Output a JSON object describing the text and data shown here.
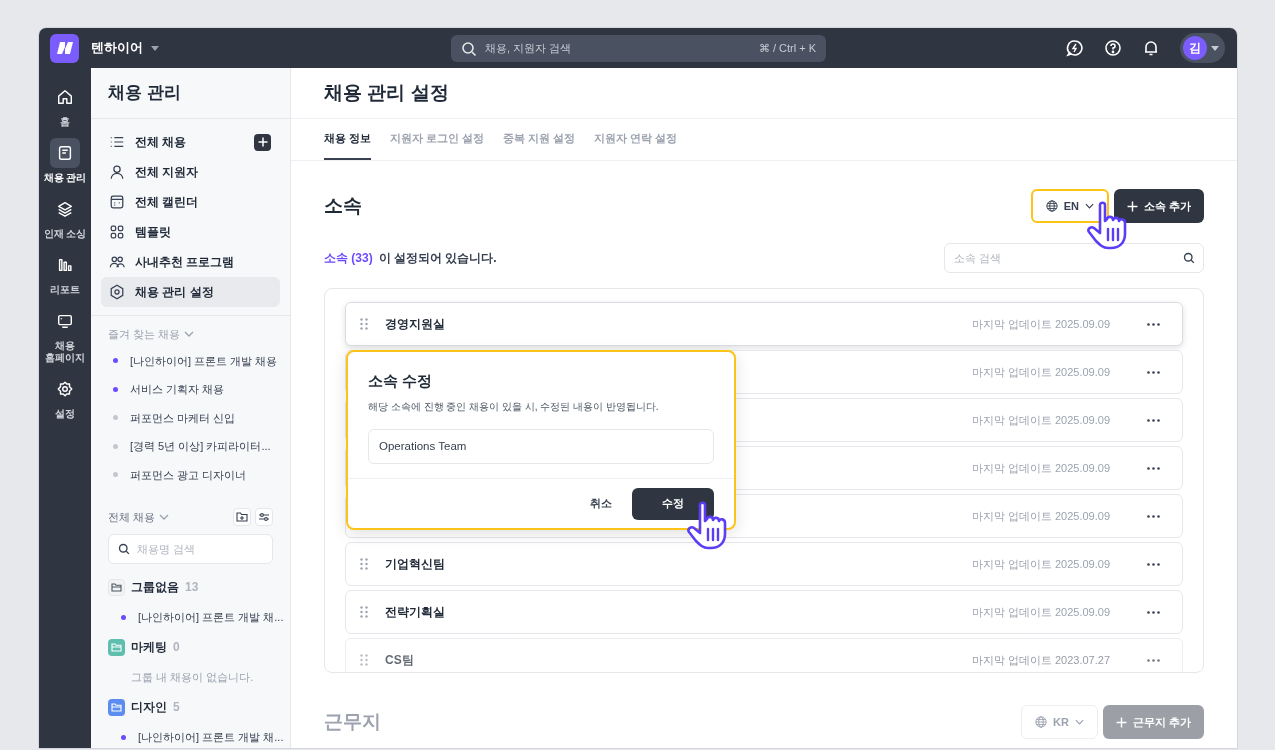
{
  "topbar": {
    "company": "텐하이어",
    "search": {
      "placeholder": "채용, 지원자 검색",
      "shortcut": "⌘ / Ctrl + K"
    },
    "avatar": "김"
  },
  "rail": [
    {
      "label": "홈",
      "selected": false
    },
    {
      "label": "채용 관리",
      "selected": true
    },
    {
      "label": "인재 소싱",
      "selected": false
    },
    {
      "label": "리포트",
      "selected": false
    },
    {
      "label": "채용 홈페이지",
      "selected": false
    },
    {
      "label": "설정",
      "selected": false
    }
  ],
  "sidebar": {
    "title": "채용 관리",
    "nav": [
      {
        "label": "전체 채용",
        "selected": false,
        "has_add": true
      },
      {
        "label": "전체 지원자",
        "selected": false,
        "has_add": false
      },
      {
        "label": "전체 캘린더",
        "selected": false,
        "has_add": false
      },
      {
        "label": "템플릿",
        "selected": false,
        "has_add": false
      },
      {
        "label": "사내추천 프로그램",
        "selected": false,
        "has_add": false
      },
      {
        "label": "채용 관리 설정",
        "selected": true,
        "has_add": false
      }
    ],
    "favorites": {
      "title": "즐겨 찾는 채용",
      "items": [
        {
          "label": "[나인하이어] 프론트 개발 채용",
          "color": "#6d4aff"
        },
        {
          "label": "서비스 기획자 채용",
          "color": "#6d4aff"
        },
        {
          "label": "퍼포먼스 마케터 신입",
          "color": "#c4c7cf"
        },
        {
          "label": "[경력 5년 이상] 카피라이터...",
          "color": "#c4c7cf"
        },
        {
          "label": "퍼포먼스 광고 디자이너",
          "color": "#c4c7cf"
        }
      ]
    },
    "all_jobs": {
      "title": "전체 채용",
      "search_placeholder": "채용명 검색",
      "groups": [
        {
          "name": "그룹없음",
          "count": "13",
          "color": "#f3f4f6",
          "items": [
            {
              "label": "[나인하이어] 프론트 개발 채...",
              "color": "#6d4aff"
            }
          ]
        },
        {
          "name": "마케팅",
          "count": "0",
          "color": "#5fbfae",
          "empty": "그룹 내 채용이 없습니다."
        },
        {
          "name": "디자인",
          "count": "5",
          "color": "#5b8cf0",
          "items": [
            {
              "label": "[나인하이어] 프론트 개발 채...",
              "color": "#6d4aff"
            }
          ]
        }
      ]
    }
  },
  "page": {
    "title": "채용 관리 설정",
    "tabs": [
      {
        "label": "채용 정보",
        "selected": true
      },
      {
        "label": "지원자 로그인 설정",
        "selected": false
      },
      {
        "label": "중복 지원 설정",
        "selected": false
      },
      {
        "label": "지원자 연락 설정",
        "selected": false
      }
    ]
  },
  "sections": [
    {
      "title": "소속",
      "dimmed": false,
      "language": "EN",
      "language_highlighted": true,
      "add_label": "소속 추가",
      "count_link": "소속 (33)",
      "count_text": "이 설정되어 있습니다.",
      "search_placeholder": "소속 검색",
      "rows": [
        {
          "name": "경영지원실",
          "updated": "마지막 업데이트 2025.09.09",
          "raised": true,
          "faded": false
        },
        {
          "updated": "마지막 업데이트 2025.09.09",
          "raised": false,
          "faded": false
        },
        {
          "updated": "마지막 업데이트 2025.09.09",
          "raised": false,
          "faded": false
        },
        {
          "updated": "마지막 업데이트 2025.09.09",
          "raised": false,
          "faded": false
        },
        {
          "updated": "마지막 업데이트 2025.09.09",
          "raised": false,
          "faded": false
        },
        {
          "name": "기업혁신팀",
          "updated": "마지막 업데이트 2025.09.09",
          "raised": false,
          "faded": false
        },
        {
          "name": "전략기획실",
          "updated": "마지막 업데이트 2025.09.09",
          "raised": false,
          "faded": false
        },
        {
          "name": "CS팀",
          "updated": "마지막 업데이트 2023.07.27",
          "raised": false,
          "faded": true
        }
      ]
    },
    {
      "title": "근무지",
      "dimmed": true,
      "language": "KR",
      "language_highlighted": false,
      "add_label": "근무지 추가"
    }
  ],
  "dialog": {
    "title": "소속 수정",
    "description": "해당 소속에 진행 중인 채용이 있을 시, 수정된 내용이 반영됩니다.",
    "value": "Operations Team",
    "cancel": "취소",
    "confirm": "수정"
  }
}
